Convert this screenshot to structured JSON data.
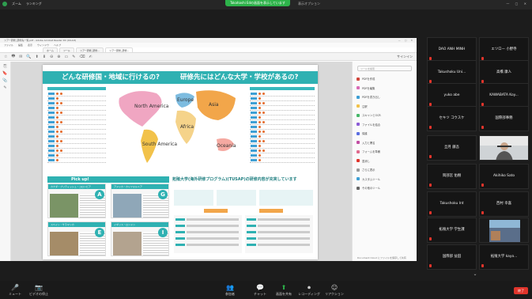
{
  "top": {
    "left_labels": [
      "ズーム",
      "ランキング"
    ],
    "share_status": "Takahashi Edの画面を表示しています",
    "view_options": "表示オプション",
    "window_controls": "— ▢ ✕"
  },
  "viewer": {
    "title": "ツアー研修_研修先一覧.pdf - Adobe Acrobat Reader DC (64-bit)",
    "window_controls": "— ▢ ✕",
    "menu": [
      "ファイル",
      "編集",
      "表示",
      "ウィンドウ",
      "ヘルプ"
    ],
    "tabs": [
      "ホーム",
      "ツール",
      "ツアー研修_研修...",
      "ツアー研修_研修..."
    ],
    "tool_icons": [
      "☆",
      "🖶",
      "✉",
      "🔍",
      "⬆",
      "⬇",
      "⊖",
      "⊕",
      "▭",
      "✎",
      "⌫",
      "✍"
    ],
    "sign_in": "サインイン",
    "left_icons": [
      "⎘",
      "🔖",
      "📎",
      "✎"
    ],
    "page": {
      "heading_left": "どんな研修国・地域に行けるの?",
      "heading_right": "研修先にはどんな大学・学校があるの?",
      "pickup_label": "Pick up!",
      "card_captions": [
        "カナダ・ブリティッシュ・コロンビア",
        "アメリカ・カリフォルニア",
        "スペイン・サラマンカ",
        "イギリス・ロンドン"
      ],
      "badges": [
        "A",
        "G",
        "E",
        "I"
      ],
      "program_heading": "拓殖大学(海外研修プログラム)(TUSAP)の研修内容が充実しています",
      "map_labels": [
        "North America",
        "Europe",
        "Asia",
        "South America",
        "Oceania",
        "Africa"
      ]
    },
    "right_pane": {
      "search_placeholder": "ツールを検索",
      "items": [
        "PDFを作成",
        "PDFを編集",
        "PDFを書き出し",
        "注釈",
        "スキャンとOCR",
        "ファイルを結合",
        "保護",
        "入力と署名",
        "フォームを準備",
        "墨消し",
        "さらに表示",
        "カスタムツール",
        "その他のツール"
      ],
      "footer": "Document Cloud にファイルを保存して共有"
    }
  },
  "participants": [
    "DAO ANH MINH",
    "エツロー 小野寺",
    "Takushoku Uni...",
    "高橋 康人",
    "yuko abe",
    "KAWABATA Koy...",
    "セキツ コウスケ",
    "国際部事務",
    "旦月 藤吾",
    "",
    "岡部宮 佑樹",
    "Akihiko Sato",
    "Takushoku Int",
    "西村 幸喜",
    "拓殖大学 学生課",
    "",
    "国際部 益田",
    "拓殖大学 kayo..."
  ],
  "bottom": {
    "audio": "ミュート",
    "video": "ビデオの停止",
    "participants": "参加者",
    "chat": "チャット",
    "share": "画面を共有",
    "record": "レコーディング",
    "reactions": "リアクション",
    "end": "終了"
  },
  "colors": {
    "accent_teal": "#2fb1b2",
    "zoom_green": "#2db34a",
    "end_red": "#e0342b"
  }
}
